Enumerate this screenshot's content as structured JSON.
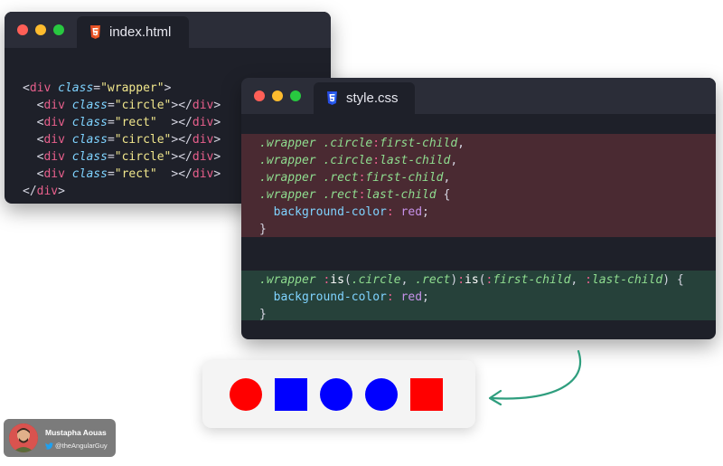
{
  "html_window": {
    "tab_label": "index.html",
    "icon": "html5-icon",
    "lines": [
      [
        {
          "t": "<",
          "c": "tag-b"
        },
        {
          "t": "div",
          "c": "tag-n"
        },
        {
          "t": " ",
          "c": "punct"
        },
        {
          "t": "class",
          "c": "attr"
        },
        {
          "t": "=",
          "c": "punct"
        },
        {
          "t": "\"wrapper\"",
          "c": "str"
        },
        {
          "t": ">",
          "c": "tag-b"
        }
      ],
      [
        {
          "t": "  <",
          "c": "tag-b"
        },
        {
          "t": "div",
          "c": "tag-n"
        },
        {
          "t": " ",
          "c": "punct"
        },
        {
          "t": "class",
          "c": "attr"
        },
        {
          "t": "=",
          "c": "punct"
        },
        {
          "t": "\"circle\"",
          "c": "str"
        },
        {
          "t": "></",
          "c": "tag-b"
        },
        {
          "t": "div",
          "c": "tag-n"
        },
        {
          "t": ">",
          "c": "tag-b"
        }
      ],
      [
        {
          "t": "  <",
          "c": "tag-b"
        },
        {
          "t": "div",
          "c": "tag-n"
        },
        {
          "t": " ",
          "c": "punct"
        },
        {
          "t": "class",
          "c": "attr"
        },
        {
          "t": "=",
          "c": "punct"
        },
        {
          "t": "\"rect\"",
          "c": "str"
        },
        {
          "t": "  ></",
          "c": "tag-b"
        },
        {
          "t": "div",
          "c": "tag-n"
        },
        {
          "t": ">",
          "c": "tag-b"
        }
      ],
      [
        {
          "t": "  <",
          "c": "tag-b"
        },
        {
          "t": "div",
          "c": "tag-n"
        },
        {
          "t": " ",
          "c": "punct"
        },
        {
          "t": "class",
          "c": "attr"
        },
        {
          "t": "=",
          "c": "punct"
        },
        {
          "t": "\"circle\"",
          "c": "str"
        },
        {
          "t": "></",
          "c": "tag-b"
        },
        {
          "t": "div",
          "c": "tag-n"
        },
        {
          "t": ">",
          "c": "tag-b"
        }
      ],
      [
        {
          "t": "  <",
          "c": "tag-b"
        },
        {
          "t": "div",
          "c": "tag-n"
        },
        {
          "t": " ",
          "c": "punct"
        },
        {
          "t": "class",
          "c": "attr"
        },
        {
          "t": "=",
          "c": "punct"
        },
        {
          "t": "\"circle\"",
          "c": "str"
        },
        {
          "t": "></",
          "c": "tag-b"
        },
        {
          "t": "div",
          "c": "tag-n"
        },
        {
          "t": ">",
          "c": "tag-b"
        }
      ],
      [
        {
          "t": "  <",
          "c": "tag-b"
        },
        {
          "t": "div",
          "c": "tag-n"
        },
        {
          "t": " ",
          "c": "punct"
        },
        {
          "t": "class",
          "c": "attr"
        },
        {
          "t": "=",
          "c": "punct"
        },
        {
          "t": "\"rect\"",
          "c": "str"
        },
        {
          "t": "  ></",
          "c": "tag-b"
        },
        {
          "t": "div",
          "c": "tag-n"
        },
        {
          "t": ">",
          "c": "tag-b"
        }
      ],
      [
        {
          "t": "</",
          "c": "tag-b"
        },
        {
          "t": "div",
          "c": "tag-n"
        },
        {
          "t": ">",
          "c": "tag-b"
        }
      ]
    ]
  },
  "css_window": {
    "tab_label": "style.css",
    "icon": "css3-icon",
    "block1": [
      [
        {
          "t": ".wrapper .circle",
          "c": "sel"
        },
        {
          "t": ":",
          "c": "colon"
        },
        {
          "t": "first-child",
          "c": "pseudo"
        },
        {
          "t": ",",
          "c": "punct"
        }
      ],
      [
        {
          "t": ".wrapper .circle",
          "c": "sel"
        },
        {
          "t": ":",
          "c": "colon"
        },
        {
          "t": "last-child",
          "c": "pseudo"
        },
        {
          "t": ",",
          "c": "punct"
        }
      ],
      [
        {
          "t": ".wrapper .rect",
          "c": "sel"
        },
        {
          "t": ":",
          "c": "colon"
        },
        {
          "t": "first-child",
          "c": "pseudo"
        },
        {
          "t": ",",
          "c": "punct"
        }
      ],
      [
        {
          "t": ".wrapper .rect",
          "c": "sel"
        },
        {
          "t": ":",
          "c": "colon"
        },
        {
          "t": "last-child",
          "c": "pseudo"
        },
        {
          "t": " {",
          "c": "punct"
        }
      ],
      [
        {
          "t": "  background-color",
          "c": "prop"
        },
        {
          "t": ": ",
          "c": "colon"
        },
        {
          "t": "red",
          "c": "val"
        },
        {
          "t": ";",
          "c": "punct"
        }
      ],
      [
        {
          "t": "}",
          "c": "punct"
        }
      ]
    ],
    "block2": [
      [
        {
          "t": ".wrapper ",
          "c": "sel"
        },
        {
          "t": ":",
          "c": "colon"
        },
        {
          "t": "is",
          "c": "fn"
        },
        {
          "t": "(",
          "c": "punct"
        },
        {
          "t": ".circle",
          "c": "sel"
        },
        {
          "t": ", ",
          "c": "punct"
        },
        {
          "t": ".rect",
          "c": "sel"
        },
        {
          "t": ")",
          "c": "punct"
        },
        {
          "t": ":",
          "c": "colon"
        },
        {
          "t": "is",
          "c": "fn"
        },
        {
          "t": "(",
          "c": "punct"
        },
        {
          "t": ":",
          "c": "colon"
        },
        {
          "t": "first-child",
          "c": "pseudo"
        },
        {
          "t": ", ",
          "c": "punct"
        },
        {
          "t": ":",
          "c": "colon"
        },
        {
          "t": "last-child",
          "c": "pseudo"
        },
        {
          "t": ") {",
          "c": "punct"
        }
      ],
      [
        {
          "t": "  background-color",
          "c": "prop"
        },
        {
          "t": ": ",
          "c": "colon"
        },
        {
          "t": "red",
          "c": "val"
        },
        {
          "t": ";",
          "c": "punct"
        }
      ],
      [
        {
          "t": "}",
          "c": "punct"
        }
      ]
    ]
  },
  "preview": {
    "shapes": [
      {
        "kind": "circle",
        "color": "#ff0000"
      },
      {
        "kind": "rect",
        "color": "#0000ff"
      },
      {
        "kind": "circle",
        "color": "#0000ff"
      },
      {
        "kind": "circle",
        "color": "#0000ff"
      },
      {
        "kind": "rect",
        "color": "#ff0000"
      }
    ]
  },
  "colors": {
    "arrow": "#2f9e7e",
    "red_highlight": "#4a2a32",
    "green_highlight": "#26413a"
  },
  "author": {
    "name": "Mustapha Aouas",
    "handle": "@theAngularGuy",
    "icon": "twitter-bird-icon"
  }
}
